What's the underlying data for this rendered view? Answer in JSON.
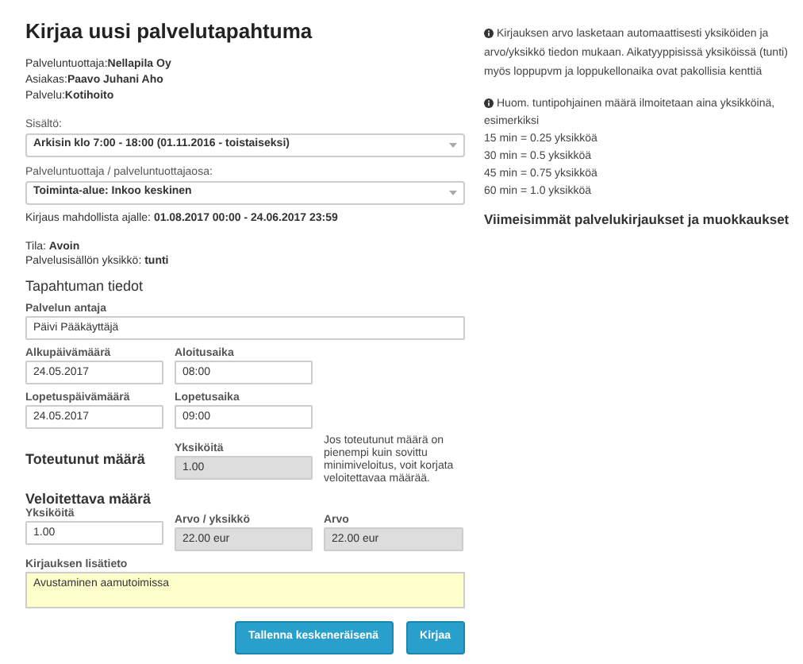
{
  "title": "Kirjaa uusi palvelutapahtuma",
  "info": [
    {
      "label": "Palveluntuottaja:",
      "value": "Nellapila Oy"
    },
    {
      "label": "Asiakas:",
      "value": "Paavo Juhani Aho"
    },
    {
      "label": "Palvelu:",
      "value": "Kotihoito"
    }
  ],
  "selects": [
    {
      "label": "Sisältö:",
      "value": "Arkisin klo 7:00 - 18:00 (01.11.2016 - toistaiseksi)"
    },
    {
      "label": "Palveluntuottaja / palveluntuottajaosa:",
      "value": "Toiminta-alue: Inkoo keskinen"
    }
  ],
  "period": {
    "label": "Kirjaus mahdollista ajalle:",
    "value": "01.08.2017 00:00 - 24.06.2017 23:59"
  },
  "status": [
    {
      "label": "Tila:",
      "value": "Avoin"
    },
    {
      "label": "Palvelusisällön yksikkö:",
      "value": "tunti"
    }
  ],
  "section_title": "Tapahtuman tiedot",
  "provider_field": {
    "label": "Palvelun antaja",
    "value": "Päivi Pääkäyttäjä"
  },
  "dates": [
    {
      "label": "Alkupäivämäärä",
      "value": "24.05.2017"
    },
    {
      "label": "Aloitusaika",
      "value": "08:00"
    },
    {
      "label": "Lopetuspäivämäärä",
      "value": "24.05.2017"
    },
    {
      "label": "Lopetusaika",
      "value": "09:00"
    }
  ],
  "actual": {
    "title": "Toteutunut määrä",
    "unit_label": "Yksiköitä",
    "value": "1.00",
    "disabled": true,
    "note": "Jos toteutunut määrä on pienempi kuin sovittu minimiveloitus, voit korjata veloitettavaa määrää."
  },
  "billed": {
    "title": "Veloitettava määrä",
    "fields": [
      {
        "label": "Yksiköitä",
        "value": "1.00",
        "disabled": false
      },
      {
        "label": "Arvo / yksikkö",
        "value": "22.00 eur",
        "disabled": true
      },
      {
        "label": "Arvo",
        "value": "22.00 eur",
        "disabled": true
      }
    ]
  },
  "notes_field": {
    "label": "Kirjauksen lisätieto",
    "value": "Avustaminen aamutoimissa"
  },
  "buttons": [
    "Tallenna keskeneräisenä",
    "Kirjaa"
  ],
  "help": [
    {
      "text": "Kirjauksen arvo lasketaan automaattisesti yksiköiden ja arvo/yksikkö tiedon mukaan. Aikatyyppisissä yksiköissä (tunti) myös loppupvm ja loppukellonaika ovat pakollisia kenttiä"
    },
    {
      "text": "Huom. tuntipohjainen määrä ilmoitetaan aina yksikköinä, esimerkiksi",
      "lines": [
        "15 min = 0.25 yksikköä",
        "30 min = 0.5 yksikköä",
        "45 min = 0.75 yksikköä",
        "60 min = 1.0 yksikköä"
      ]
    }
  ],
  "recent_heading": "Viimeisimmät palvelukirjaukset ja muokkaukset"
}
